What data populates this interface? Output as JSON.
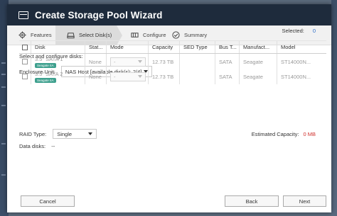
{
  "window": {
    "title": "Create Storage Pool Wizard"
  },
  "steps": [
    {
      "label": "Features",
      "icon": "gear-icon"
    },
    {
      "label": "Select Disk(s)",
      "icon": "disk-icon"
    },
    {
      "label": "Configure",
      "icon": "storage-icon"
    },
    {
      "label": "Summary",
      "icon": "check-circle-icon"
    }
  ],
  "section": {
    "title": "Select and configure disks:"
  },
  "enclosure": {
    "label": "Enclosure Unit:",
    "value": "NAS Host [available disk(s): 2/4]"
  },
  "selected": {
    "label": "Selected:",
    "value": "0"
  },
  "table": {
    "headers": [
      "Disk",
      "Stat...",
      "Mode",
      "Capacity",
      "SED Type",
      "Bus T...",
      "Manufact...",
      "Model"
    ],
    "rows": [
      {
        "disk": "3.5\" SATA 1",
        "badge": "Seagate IIA",
        "status": "None",
        "mode": "-",
        "capacity": "12.73 TB",
        "sed": "",
        "bus": "SATA",
        "manufacturer": "Seagate",
        "model": "ST14000N..."
      },
      {
        "disk": "3.5\" SATA 2",
        "badge": "Seagate IIA",
        "status": "None",
        "mode": "-",
        "capacity": "12.73 TB",
        "sed": "",
        "bus": "SATA",
        "manufacturer": "Seagate",
        "model": "ST14000N..."
      }
    ]
  },
  "raid": {
    "label": "RAID Type:",
    "value": "Single"
  },
  "estimated": {
    "label": "Estimated Capacity:",
    "value": "0 MB"
  },
  "datadisks": {
    "label": "Data disks:",
    "value": "--"
  },
  "buttons": {
    "cancel": "Cancel",
    "back": "Back",
    "next": "Next"
  },
  "colors": {
    "titlebar": "#1e2b3c",
    "link_blue": "#2a6cc8",
    "warn_red": "#d0312d",
    "badge_teal": "#3ea08e"
  }
}
